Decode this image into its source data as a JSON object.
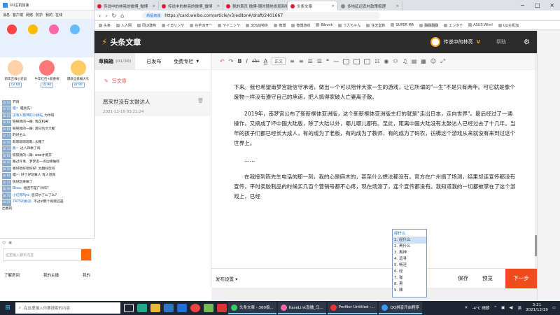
{
  "browser": {
    "tabs": [
      {
        "label": "传说中的林亮的微博_微博"
      },
      {
        "label": "传说中的林亮的微博_微博"
      },
      {
        "label": "我的首页 微博-随时随地发现新鲜事"
      },
      {
        "label": "头条文章"
      },
      {
        "label": "多地延迟农村政策梳理"
      }
    ],
    "url": "https://card.weibo.com/article/v3/editor#/draft/2401667",
    "url_badge": "新版商城",
    "bookmarks": [
      "头条",
      "入人网",
      "同UI建构",
      "イ日リンゲ",
      "在芋派开一",
      "ヤイニシヤ",
      "3DS动物乡",
      "微博",
      "微博游戏",
      "Bibook",
      "う人ちゃん",
      "任天堂新",
      "SUPER MA",
      "翻翻翻翻",
      "エンタテ",
      "ASUS Wiml",
      "UU主机加"
    ]
  },
  "left_app": {
    "title": "UU主机加速",
    "toolbar": [
      "消息",
      "客户端",
      "网络",
      "防护",
      "我的",
      "在线"
    ],
    "gifts": [
      {
        "name": "新年吉祥小老鼠",
        "level": "LV 64"
      },
      {
        "name": "牛年红包+新春祝",
        "level": "LV 90"
      },
      {
        "name": "爆款全家桶大礼",
        "level": "LV 90"
      }
    ],
    "chat": [
      {
        "badge": "LV 64",
        "name": "",
        "text": "节目"
      },
      {
        "badge": "LV 43",
        "name": "喵~",
        "text": "喵亮先!"
      },
      {
        "badge": "LV 21",
        "name": "没有人猪神的小耕耘",
        "text": "为你呀"
      },
      {
        "badge": "LV 61",
        "name": "",
        "text": "铁铁我的一眼: 我这机男"
      },
      {
        "badge": "LV 61",
        "name": "",
        "text": "铁铁我的一眼: 渡日凯文大聚"
      },
      {
        "badge": "LV 13",
        "name": "",
        "text": "的好主么"
      },
      {
        "badge": "LV 56",
        "name": "",
        "text": "嗯嗯嗯嗯嗯嗯: 太糖了"
      },
      {
        "badge": "LV 13",
        "name": "路~",
        "text": "过八四季了吗"
      },
      {
        "badge": "LV 61",
        "name": "",
        "text": "铁铁我的一眼: woe才要开"
      },
      {
        "badge": "LV 43",
        "name": "",
        "text": "路过许事、梦梦友一点边缘破碎"
      },
      {
        "badge": "LV 20",
        "name": "",
        "text": "哪好嗯好嗯好好: 太翻好玩吗"
      },
      {
        "badge": "LV 61",
        "name": "",
        "text": "喵~: 好了好玩嘛人 有人觉佩"
      },
      {
        "badge": "LV 21",
        "name": "",
        "text": "佩好玩来嘛了"
      },
      {
        "badge": "LV 49",
        "name": "Bkaa:",
        "text": "他因不是广州吗?"
      },
      {
        "badge": "LV 70",
        "name": "小红莓Ryu:",
        "text": "您试尔了么了么?"
      },
      {
        "badge": "LV 21",
        "name": "7475的群友:",
        "text": "不过sf那个视频还是"
      },
      {
        "badge": "",
        "name": "",
        "text": "出圈的"
      }
    ],
    "input_placeholder": "这里输入聊天内容",
    "bottom_left": "了解房间",
    "bottom_mid": "我的主播",
    "bottom_right": "我的"
  },
  "app": {
    "logo": "头条文章",
    "username": "传说中的林亮",
    "help": "帮助"
  },
  "sidebar": {
    "tabs": [
      "草稿箱",
      "已发布",
      "免费专栏"
    ],
    "draft_count": "(01/30)",
    "new_draft": "写文章",
    "drafts": [
      {
        "title": "愿来世没有太鼓达人",
        "date": "2021-12-19 03:21:24"
      }
    ]
  },
  "toolbar": {
    "paragraph_select": "正文"
  },
  "content": {
    "paragraphs": [
      {
        "text": "下来。我也希望南梦宫能信守承诺，做出一个可以陪伴大家一生的游戏，让它所谓的\"一生\"不是只有两年。可它就是像个废物一样没有遵守自己的承诺，把人搞得家破人亡妻离子散。",
        "indent": false
      },
      {
        "text": "2019年，南梦宫公布了新新框体亚洲版，这个新新框体亚洲版主打的就是\"走出日本，走向世界\"。最后经过了一通操作，又搞成了坏中国大陆版，除了大陆以外，哪儿哪儿都有。至此，距离中国大陆没有太鼓达人已经过去了十几年。当年的孩子们都已经长大成人，有的成为了老板，有的成为了教师，有的成为了码农，彷彿这个游戏从来就没有来到过这个世界上。",
        "indent": true
      },
      {
        "text": "……",
        "indent": true
      },
      {
        "text": "在我接到陈先生电话的那一刻，我的心是麻木的，甚至什么想法都没有。官方在广州搞了场测，结果却连宣传都没有宣传，平时卖胶制品的时候买几百个营销号都不心疼，现在场测了，连个宣传都没有。我知道我的一切都被掌在了这个游戏上，已经",
        "indent": true
      }
    ]
  },
  "editor_bottom": {
    "publish_settings": "发布设置",
    "save": "保存",
    "preview": "预览",
    "next": "下一步"
  },
  "ime": {
    "input": "经什么",
    "candidates": [
      "经什么",
      "黑什么",
      "奥神",
      "追寻",
      "畅淫",
      "经",
      "崔",
      "黑",
      "陳"
    ]
  },
  "taskbar": {
    "search": "在这里输入你要搜索的内容",
    "apps": [
      "头条文章 - 360极...",
      "KaseLink直播_马...",
      "Profiler Untitled -...",
      "QQ拼音开启程序"
    ],
    "weather": "-4°C 晴朗",
    "time": "3:21",
    "date": "2021/12/19",
    "lang": "英"
  }
}
